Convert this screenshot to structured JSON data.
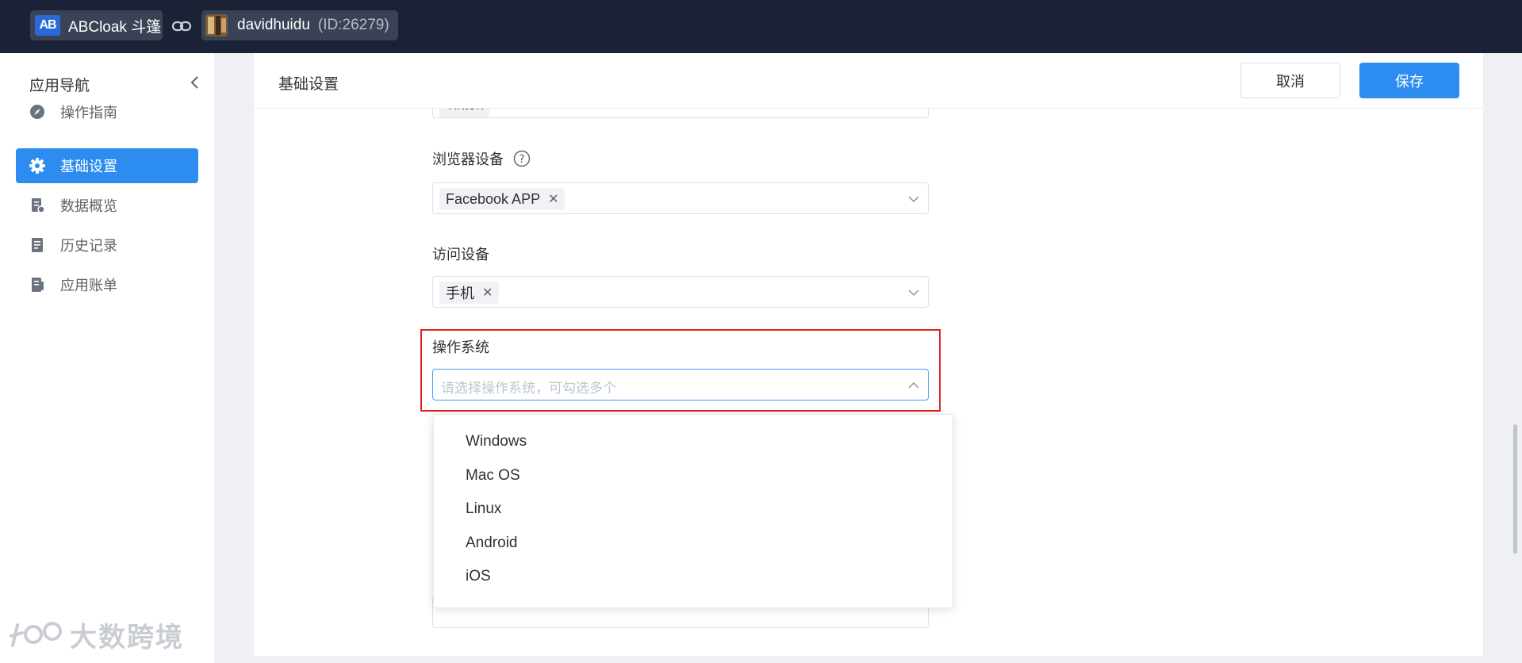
{
  "topbar": {
    "app_name": "ABCloak 斗篷",
    "app_logo_text": "AB",
    "user_name": "davidhuidu",
    "user_id": "(ID:26279)"
  },
  "sidebar": {
    "title": "应用导航",
    "items": [
      {
        "label": "操作指南",
        "icon": "compass-icon"
      },
      {
        "label": "基础设置",
        "icon": "gear-icon",
        "active": true
      },
      {
        "label": "数据概览",
        "icon": "data-doc-icon"
      },
      {
        "label": "历史记录",
        "icon": "history-doc-icon"
      },
      {
        "label": "应用账单",
        "icon": "bill-doc-icon"
      }
    ],
    "watermark": "大数跨境"
  },
  "main": {
    "title": "基础设置",
    "cancel_label": "取消",
    "save_label": "保存",
    "top_tag_partial": "Tiktok",
    "browser_device": {
      "label": "浏览器设备",
      "tag": "Facebook APP"
    },
    "access_device": {
      "label": "访问设备",
      "tag": "手机"
    },
    "os": {
      "label": "操作系统",
      "placeholder": "请选择操作系统，可勾选多个",
      "options": [
        "Windows",
        "Mac OS",
        "Linux",
        "Android",
        "iOS"
      ]
    }
  },
  "colors": {
    "topbar_bg": "#1b2236",
    "accent": "#2d8cf0",
    "highlight_border": "#e02020"
  }
}
